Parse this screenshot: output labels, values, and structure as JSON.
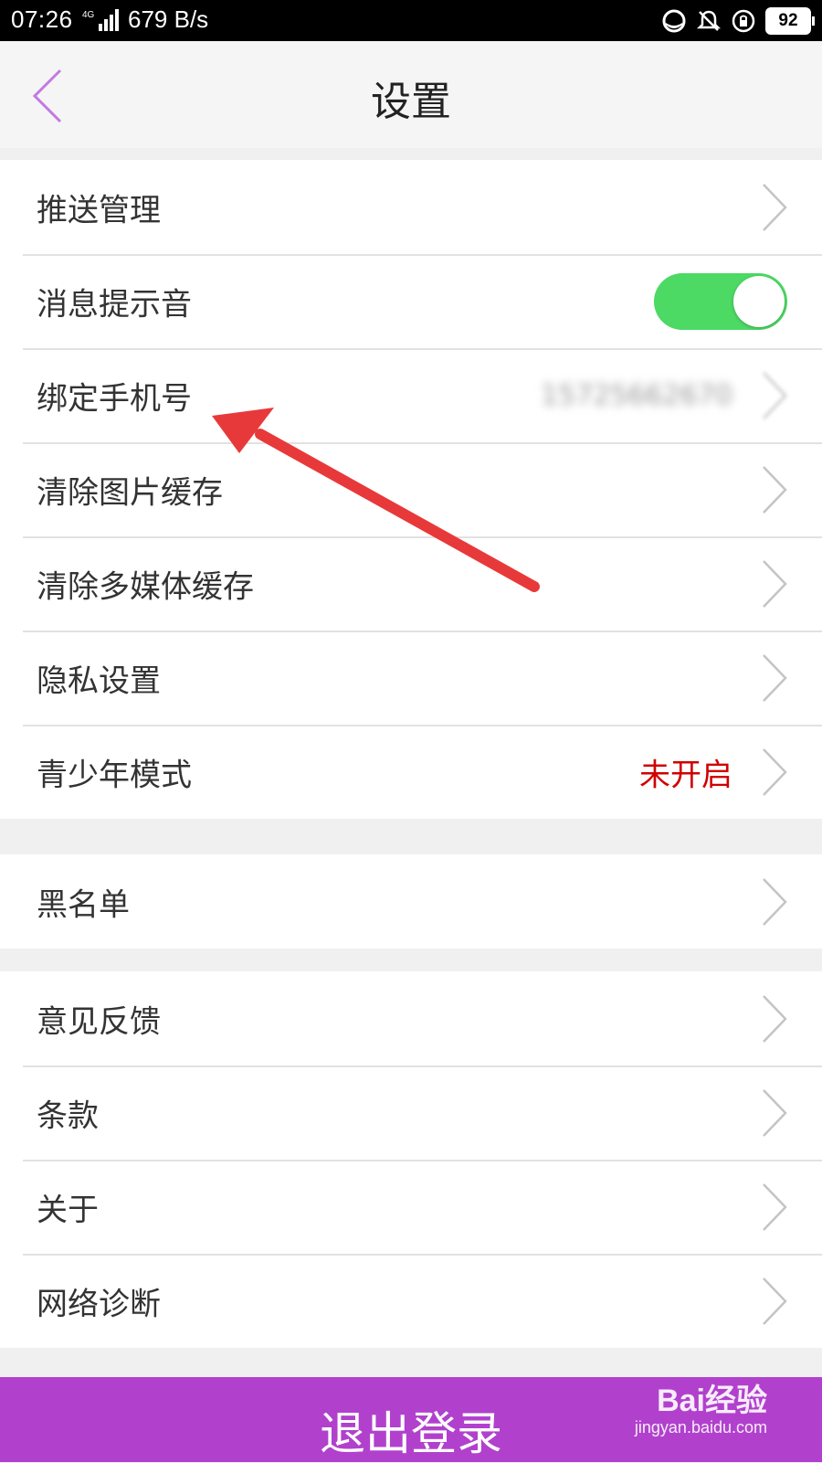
{
  "status_bar": {
    "time": "07:26",
    "network": "4G",
    "speed": "679 B/s",
    "battery": "92",
    "icons": [
      "data-saver-icon",
      "mute-icon",
      "rotation-lock-icon",
      "battery-icon"
    ]
  },
  "header": {
    "title": "设置",
    "back_icon": "chevron-left-icon"
  },
  "sections": [
    {
      "items": [
        {
          "label": "推送管理",
          "accessory": "chevron"
        },
        {
          "label": "消息提示音",
          "accessory": "toggle",
          "toggle_on": true
        },
        {
          "label": "绑定手机号",
          "accessory": "chevron",
          "value": "15725662670",
          "value_blurred": true
        },
        {
          "label": "清除图片缓存",
          "accessory": "chevron"
        },
        {
          "label": "清除多媒体缓存",
          "accessory": "chevron"
        },
        {
          "label": "隐私设置",
          "accessory": "chevron"
        },
        {
          "label": "青少年模式",
          "accessory": "chevron",
          "value": "未开启",
          "value_color": "#d00000"
        }
      ]
    },
    {
      "items": [
        {
          "label": "黑名单",
          "accessory": "chevron"
        }
      ]
    },
    {
      "items": [
        {
          "label": "意见反馈",
          "accessory": "chevron"
        },
        {
          "label": "条款",
          "accessory": "chevron"
        },
        {
          "label": "关于",
          "accessory": "chevron"
        },
        {
          "label": "网络诊断",
          "accessory": "chevron"
        }
      ]
    }
  ],
  "logout": {
    "label": "退出登录"
  },
  "watermark": {
    "line1": "Bai经验",
    "line2": "jingyan.baidu.com"
  },
  "colors": {
    "accent": "#b141cd",
    "toggle_on": "#4cd964",
    "warning_text": "#d00000",
    "annotation_arrow": "#e8393a"
  }
}
